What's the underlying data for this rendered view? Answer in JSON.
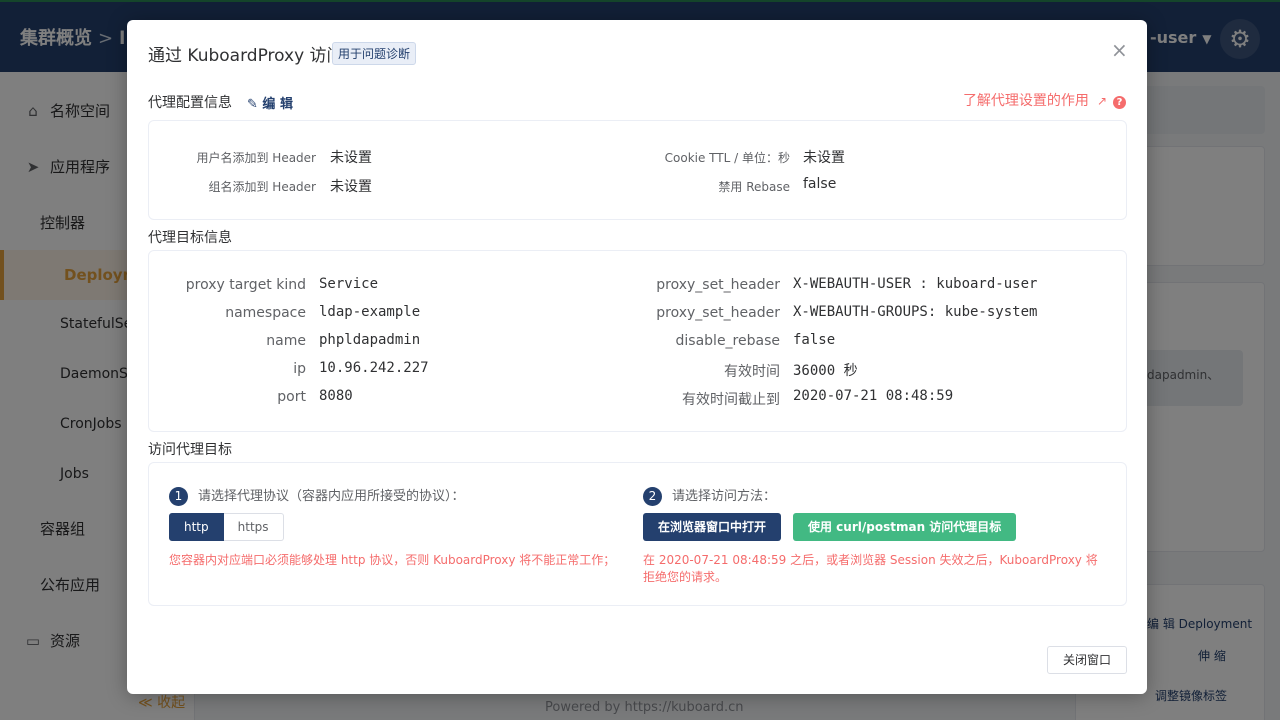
{
  "topbar": {
    "breadcrumb_root": "集群概览",
    "breadcrumb_sep": ">",
    "breadcrumb_next": "l",
    "username": "-user",
    "caret": "▼"
  },
  "sidebar": {
    "items": [
      {
        "label": "名称空间",
        "icon": "home-icon"
      },
      {
        "label": "应用程序",
        "icon": "send-icon"
      },
      {
        "label": "控制器"
      },
      {
        "label": "Deployme"
      },
      {
        "label": "StatefulSet"
      },
      {
        "label": "DaemonSe"
      },
      {
        "label": "CronJobs"
      },
      {
        "label": "Jobs"
      },
      {
        "label": "容器组"
      },
      {
        "label": "公布应用"
      },
      {
        "label": "资源",
        "icon": "box-icon"
      }
    ],
    "collapse": "≪ 收起"
  },
  "background": {
    "snippet1": "dapadmin、",
    "edit_deployment": "编 辑 Deployment",
    "scale": "伸 缩",
    "adjust_image": "调整镜像标签",
    "footer": "Powered by https://kuboard.cn"
  },
  "dialog": {
    "title": "通过 KuboardProxy 访问",
    "tag": "用于问题诊断",
    "close_icon": "×",
    "section_config": "代理配置信息",
    "edit": "编 辑",
    "learn_more": "了解代理设置的作用",
    "config": {
      "left": [
        {
          "label": "用户名添加到 Header",
          "value": "未设置"
        },
        {
          "label": "组名添加到 Header",
          "value": "未设置"
        }
      ],
      "right": [
        {
          "label": "Cookie TTL / 单位：秒",
          "value": "未设置"
        },
        {
          "label": "禁用 Rebase",
          "value": "false"
        }
      ]
    },
    "section_target": "代理目标信息",
    "target": {
      "left": [
        {
          "label": "proxy target kind",
          "value": "Service"
        },
        {
          "label": "namespace",
          "value": "ldap-example"
        },
        {
          "label": "name",
          "value": "phpldapadmin"
        },
        {
          "label": "ip",
          "value": "10.96.242.227"
        },
        {
          "label": "port",
          "value": "8080"
        }
      ],
      "right": [
        {
          "label": "proxy_set_header",
          "value": "X-WEBAUTH-USER : kuboard-user"
        },
        {
          "label": "proxy_set_header",
          "value": "X-WEBAUTH-GROUPS: kube-system"
        },
        {
          "label": "disable_rebase",
          "value": "false"
        },
        {
          "label": "有效时间",
          "value": "36000 秒"
        },
        {
          "label": "有效时间截止到",
          "value": "2020-07-21 08:48:59"
        }
      ]
    },
    "section_access": "访问代理目标",
    "step1": {
      "num": "1",
      "text": "请选择代理协议（容器内应用所接受的协议）："
    },
    "protocols": [
      "http",
      "https"
    ],
    "warn1": "您容器内对应端口必须能够处理 http 协议，否则 KuboardProxy 将不能正常工作；",
    "step2": {
      "num": "2",
      "text": "请选择访问方法："
    },
    "btn_browser": "在浏览器窗口中打开",
    "btn_curl": "使用 curl/postman 访问代理目标",
    "warn2": "在 2020-07-21 08:48:59 之后，或者浏览器 Session 失效之后，KuboardProxy 将拒绝您的请求。",
    "close_button": "关闭窗口"
  },
  "colors": {
    "primary": "#24406e",
    "success": "#42b983",
    "danger": "#f56c6c",
    "accent": "#e6a23c"
  }
}
